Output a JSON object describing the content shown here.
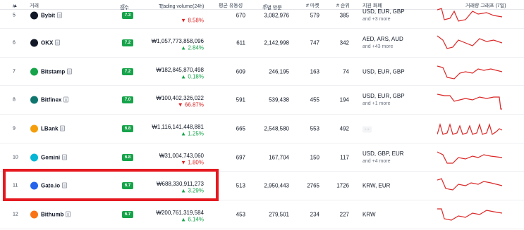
{
  "header": {
    "rank": "#",
    "rank_sort": "▲",
    "exchange": "거래",
    "score": "점수",
    "volume": "Trading volume(24h)",
    "liquidity": "평균 유동성",
    "visits": "주별 방문",
    "markets": "# 마켓",
    "coins": "# 순위",
    "fiat": "지원 화폐",
    "graph": "거래량 그래프 (7일)"
  },
  "colors": {
    "score_badge": "#16a34a",
    "up": "#16a34a",
    "down": "#dc2626",
    "sparkline": "#dc2626",
    "highlight": "#e5191f"
  },
  "rows": [
    {
      "rank": "5",
      "name": "Bybit",
      "logo": "BYBIT",
      "logo_color": "#111827",
      "score": "7.3",
      "volume": "",
      "change": "▼ 8.58%",
      "change_dir": "down",
      "liquidity": "670",
      "visits": "3,082,976",
      "markets": "579",
      "coins": "385",
      "fiat": "USD, EUR, GBP",
      "fiat_more": "and +3 more"
    },
    {
      "rank": "6",
      "name": "OKX",
      "logo": "OKX",
      "logo_color": "#111827",
      "score": "7.2",
      "volume": "₩1,057,773,858,096",
      "change": "▲ 2.84%",
      "change_dir": "up",
      "liquidity": "611",
      "visits": "2,142,998",
      "markets": "747",
      "coins": "342",
      "fiat": "AED, ARS, AUD",
      "fiat_more": "and +43 more"
    },
    {
      "rank": "7",
      "name": "Bitstamp",
      "logo": "BS",
      "logo_color": "#16a34a",
      "score": "7.2",
      "volume": "₩182,845,870,498",
      "change": "▲ 0.18%",
      "change_dir": "up",
      "liquidity": "609",
      "visits": "246,195",
      "markets": "163",
      "coins": "74",
      "fiat": "USD, EUR, GBP",
      "fiat_more": ""
    },
    {
      "rank": "8",
      "name": "Bitfinex",
      "logo": "BF",
      "logo_color": "#0f766e",
      "score": "7.0",
      "volume": "₩100,402,326,022",
      "change": "▼ 66.87%",
      "change_dir": "down",
      "liquidity": "591",
      "visits": "539,438",
      "markets": "455",
      "coins": "194",
      "fiat": "USD, EUR, GBP",
      "fiat_more": "and +1 more"
    },
    {
      "rank": "9",
      "name": "LBank",
      "logo": "L",
      "logo_color": "#f59e0b",
      "score": "6.8",
      "volume": "₩1,116,141,448,881",
      "change": "▲ 1.25%",
      "change_dir": "up",
      "liquidity": "665",
      "visits": "2,548,580",
      "markets": "553",
      "coins": "492",
      "fiat": "",
      "fiat_more": "",
      "fiat_dots": "···"
    },
    {
      "rank": "10",
      "name": "Gemini",
      "logo": "G",
      "logo_color": "#06b6d4",
      "score": "6.8",
      "volume": "₩31,004,743,060",
      "change": "▼ 1.80%",
      "change_dir": "down",
      "liquidity": "697",
      "visits": "167,704",
      "markets": "150",
      "coins": "117",
      "fiat": "USD, GBP, EUR",
      "fiat_more": "and +4 more"
    },
    {
      "rank": "11",
      "name": "Gate.io",
      "logo": "G",
      "logo_color": "#2563eb",
      "score": "6.7",
      "volume": "₩688,330,911,273",
      "change": "▲ 3.29%",
      "change_dir": "up",
      "liquidity": "513",
      "visits": "2,950,443",
      "markets": "2765",
      "coins": "1726",
      "fiat": "KRW, EUR",
      "fiat_more": ""
    },
    {
      "rank": "12",
      "name": "Bithumb",
      "logo": "B",
      "logo_color": "#f97316",
      "score": "6.7",
      "volume": "₩200,761,319,584",
      "change": "▲ 6.14%",
      "change_dir": "up",
      "liquidity": "453",
      "visits": "279,501",
      "markets": "234",
      "coins": "227",
      "fiat": "KRW",
      "fiat_more": ""
    }
  ]
}
